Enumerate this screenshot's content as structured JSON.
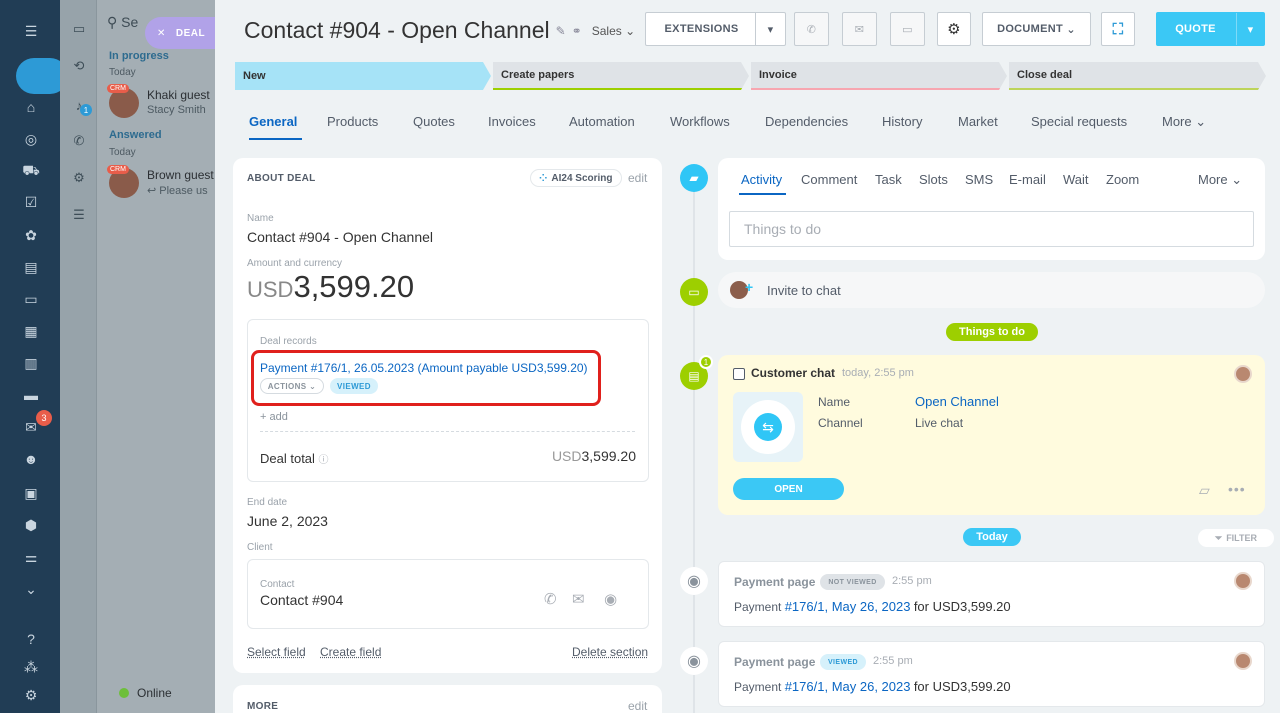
{
  "sidebar_rail": {
    "mail_badge": "3"
  },
  "chat_list": {
    "search_placeholder": "Se",
    "section_in_progress": "In progress",
    "day_today_1": "Today",
    "chat1_name": "Khaki guest",
    "chat1_sub": "Stacy Smith",
    "section_answered": "Answered",
    "day_today_2": "Today",
    "chat2_name": "Brown guest",
    "chat2_sub": "Please us",
    "crm_badge": "CRM",
    "online_status": "Online",
    "chat_badge": "1"
  },
  "deal_pill": {
    "label": "DEAL",
    "close": "✕"
  },
  "header": {
    "title": "Contact #904 - Open Channel",
    "category": "Sales",
    "extensions_label": "EXTENSIONS",
    "document_label": "DOCUMENT",
    "quote_label": "QUOTE"
  },
  "stages": [
    {
      "label": "Create papers"
    },
    {
      "label": "Invoice"
    },
    {
      "label": "Close deal"
    }
  ],
  "stage_new": "New",
  "tabs": {
    "general": "General",
    "products": "Products",
    "quotes": "Quotes",
    "invoices": "Invoices",
    "automation": "Automation",
    "workflows": "Workflows",
    "dependencies": "Dependencies",
    "history": "History",
    "market": "Market",
    "special": "Special requests",
    "more": "More"
  },
  "about": {
    "header": "ABOUT DEAL",
    "scoring": "AI24 Scoring",
    "edit": "edit",
    "name_label": "Name",
    "name_value": "Contact #904 - Open Channel",
    "amount_label": "Amount and currency",
    "amount_currency": "USD",
    "amount_value": "3,599.20",
    "records_label": "Deal records",
    "payment_link": "Payment #176/1, 26.05.2023 (Amount payable USD3,599.20)",
    "actions": "ACTIONS",
    "viewed": "VIEWED",
    "add": "+ add",
    "deal_total_label": "Deal total",
    "deal_total_currency": "USD",
    "deal_total_value": "3,599.20",
    "end_date_label": "End date",
    "end_date_value": "June 2, 2023",
    "client_label": "Client",
    "contact_label": "Contact",
    "contact_value": "Contact #904",
    "select_field": "Select field",
    "create_field": "Create field",
    "delete_section": "Delete section"
  },
  "more_card": {
    "header": "MORE",
    "edit": "edit"
  },
  "editor": {
    "tabs": [
      "Activity",
      "Comment",
      "Task",
      "Slots",
      "SMS",
      "E-mail",
      "Wait",
      "Zoom"
    ],
    "more": "More",
    "placeholder": "Things to do"
  },
  "invite": {
    "label": "Invite to chat"
  },
  "things_to_do": "Things to do",
  "chat_item": {
    "badge": "1",
    "title": "Customer chat",
    "time": "today, 2:55 pm",
    "name_label": "Name",
    "name_value": "Open Channel",
    "channel_label": "Channel",
    "channel_value": "Live chat",
    "open_button": "OPEN"
  },
  "today_pill": "Today",
  "filter": "FILTER",
  "events": [
    {
      "title": "Payment page",
      "badge": "NOT VIEWED",
      "time": "2:55 pm",
      "prefix": "Payment",
      "link": "#176/1, May 26, 2023",
      "suffix": "for USD3,599.20"
    },
    {
      "title": "Payment page",
      "badge": "VIEWED",
      "time": "2:55 pm",
      "prefix": "Payment",
      "link": "#176/1, May 26, 2023",
      "suffix": "for USD3,599.20"
    }
  ],
  "colors": {
    "accent_blue": "#0b66c3",
    "quote_button": "#3bc8f5",
    "stage_new": "#a6e3f7",
    "highlight_red": "#e0201c",
    "todo_green": "#9dcf00"
  }
}
